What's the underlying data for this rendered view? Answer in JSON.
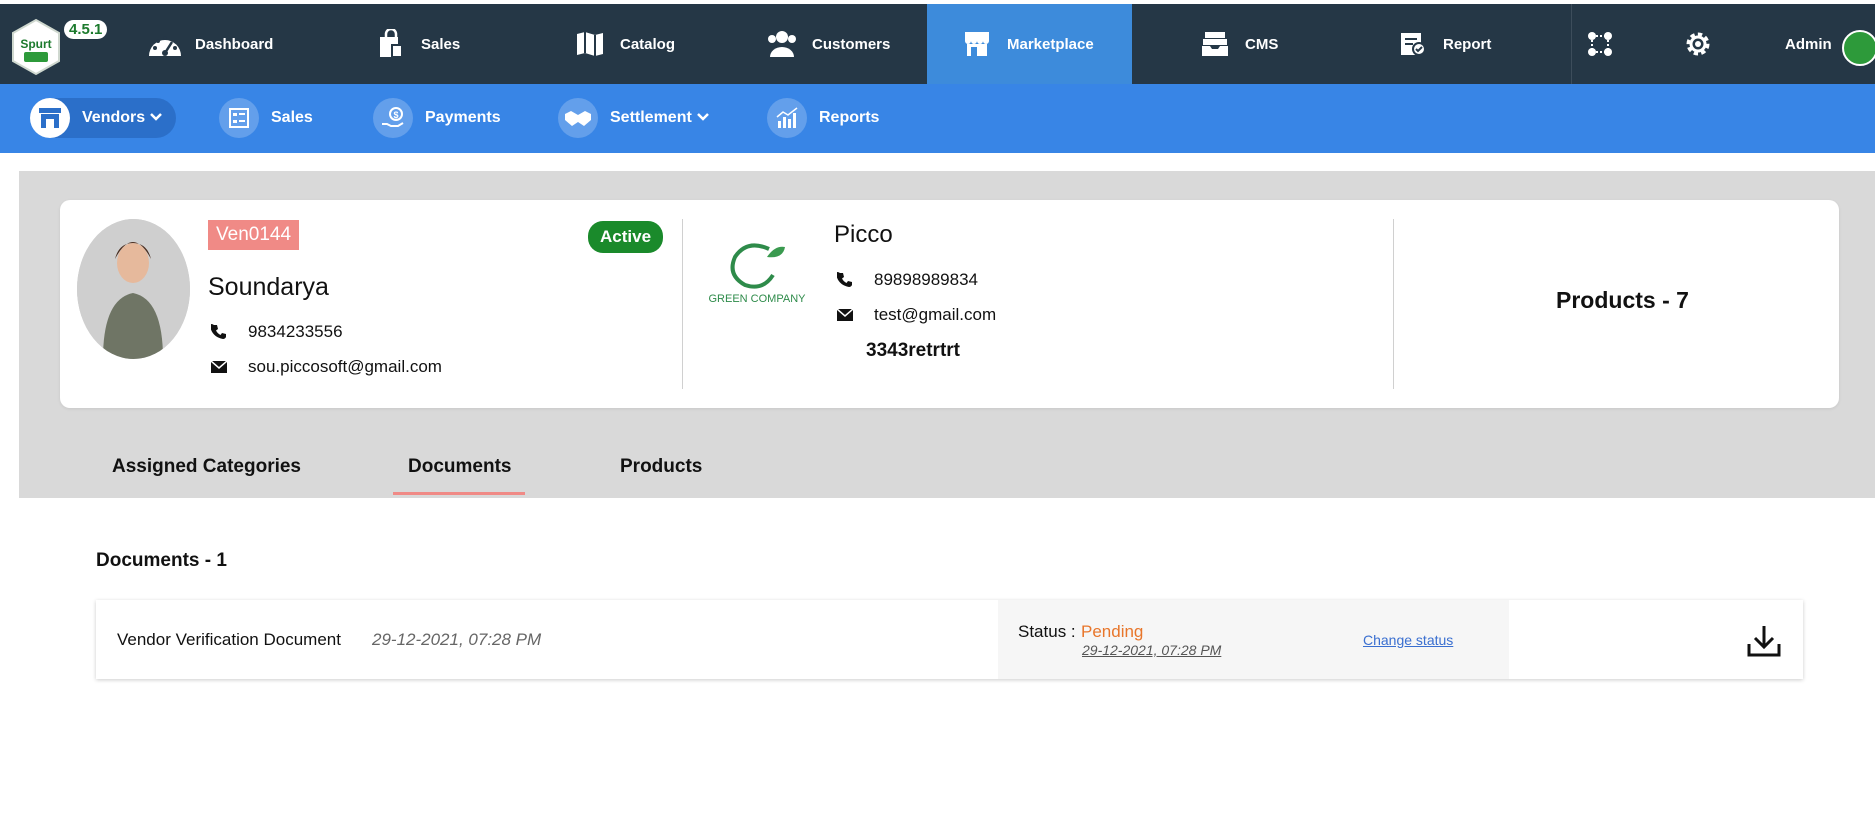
{
  "topnav": {
    "logo_text": "Spurt",
    "version": "4.5.1",
    "items": [
      {
        "label": "Dashboard",
        "icon": "dashboard-gauge-icon"
      },
      {
        "label": "Sales",
        "icon": "shopping-bag-icon"
      },
      {
        "label": "Catalog",
        "icon": "map-icon"
      },
      {
        "label": "Customers",
        "icon": "users-icon"
      },
      {
        "label": "Marketplace",
        "icon": "store-icon"
      },
      {
        "label": "CMS",
        "icon": "inbox-icon"
      },
      {
        "label": "Report",
        "icon": "report-icon"
      }
    ],
    "active": "Marketplace",
    "admin_label": "Admin"
  },
  "subnav": {
    "items": [
      {
        "label": "Vendors",
        "icon": "vendor-store-icon",
        "has_dropdown": true
      },
      {
        "label": "Sales",
        "icon": "sales-list-icon",
        "has_dropdown": false
      },
      {
        "label": "Payments",
        "icon": "payment-hand-icon",
        "has_dropdown": false
      },
      {
        "label": "Settlement",
        "icon": "handshake-icon",
        "has_dropdown": true
      },
      {
        "label": "Reports",
        "icon": "bar-chart-icon",
        "has_dropdown": false
      }
    ]
  },
  "vendor": {
    "id": "Ven0144",
    "status": "Active",
    "name": "Soundarya",
    "phone": "9834233556",
    "email": "sou.piccosoft@gmail.com"
  },
  "company": {
    "logo_text": "GREEN COMPANY",
    "name": "Picco",
    "phone": "89898989834",
    "email": "test@gmail.com",
    "address": "3343retrtrt"
  },
  "products_summary": "Products - 7",
  "tabs": [
    {
      "label": "Assigned Categories"
    },
    {
      "label": "Documents"
    },
    {
      "label": "Products"
    }
  ],
  "active_tab": "Documents",
  "documents": {
    "heading": "Documents - 1",
    "items": [
      {
        "name": "Vendor Verification Document",
        "date": "29-12-2021, 07:28 PM",
        "status_label": "Status :",
        "status": "Pending",
        "status_date": "29-12-2021, 07:28 PM",
        "change_status_label": "Change status"
      }
    ]
  },
  "colors": {
    "topnav_bg": "#253746",
    "active_nav": "#3d8bdb",
    "subnav_bg": "#3885e6",
    "vendor_id_bg": "#f08a86",
    "active_badge": "#1a8a2b",
    "pending": "#e8762b",
    "tab_underline": "#f08a86"
  }
}
